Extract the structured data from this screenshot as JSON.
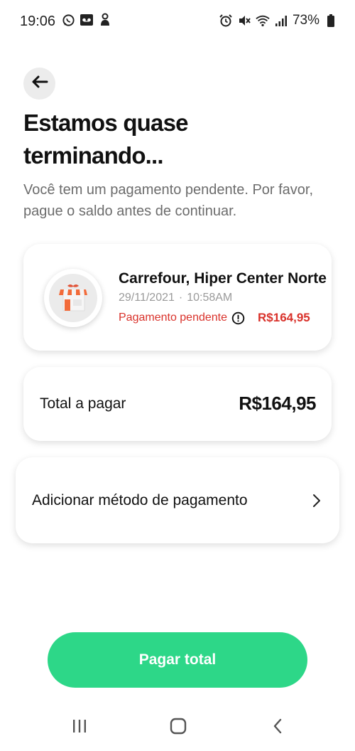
{
  "status_bar": {
    "time": "19:06",
    "battery": "73%",
    "left_icons": [
      "whatsapp-icon",
      "voicemail-icon",
      "vpn-icon"
    ],
    "right_icons": [
      "alarm-icon",
      "mute-icon",
      "wifi-icon",
      "signal-icon",
      "battery-icon"
    ]
  },
  "header": {
    "back_icon": "arrow-left-icon",
    "title": "Estamos quase terminando...",
    "subtitle": "Você tem um pagamento pendente. Por favor, pague o saldo antes de continuar."
  },
  "order": {
    "store_name": "Carrefour, Hiper Center Norte",
    "date": "29/11/2021",
    "separator": "·",
    "time": "10:58AM",
    "status": "Pagamento pendente",
    "amount": "R$164,95",
    "status_color": "#d9312a"
  },
  "total": {
    "label": "Total a pagar",
    "value": "R$164,95"
  },
  "payment_method": {
    "label": "Adicionar método de pagamento",
    "icon": "chevron-right-icon"
  },
  "primary_action": {
    "label": "Pagar total",
    "color": "#2dd788"
  },
  "nav_bar": {
    "buttons": [
      "recent-apps-icon",
      "home-icon",
      "back-icon"
    ]
  }
}
